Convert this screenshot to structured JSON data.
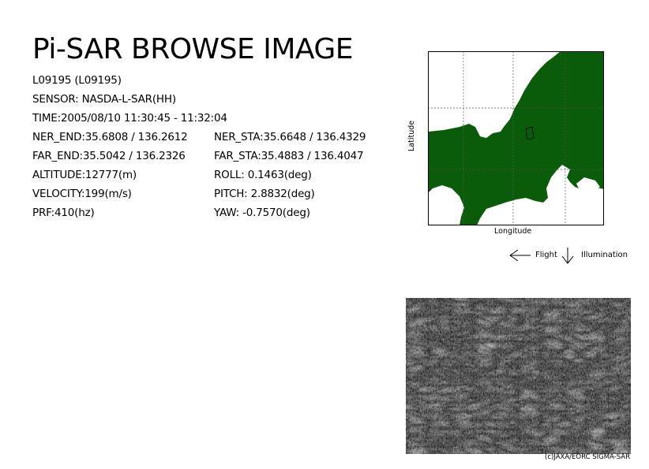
{
  "title": "Pi-SAR BROWSE IMAGE",
  "scene_id": "L09195 (L09195)",
  "sensor": "SENSOR: NASDA-L-SAR(HH)",
  "time": "TIME:2005/08/10  11:30:45 - 11:32:04",
  "left_column": [
    "NER_END:35.6808 / 136.2612",
    "FAR_END:35.5042 / 136.2326",
    "ALTITUDE:12777(m)",
    "VELOCITY:199(m/s)",
    "PRF:410(hz)"
  ],
  "right_column": [
    "NER_STA:35.6648 / 136.4329",
    "FAR_STA:35.4883 / 136.4047",
    "ROLL: 0.1463(deg)",
    "PITCH:  2.8832(deg)",
    "YAW:  -0.7570(deg)"
  ],
  "map": {
    "latitude_label": "Latitude",
    "longitude_label": "Longitude",
    "land_color": "#0a5c0a",
    "water_color": "#ffffff"
  },
  "legend": {
    "flight_label": "Flight",
    "illumination_label": "Illumination",
    "flight_icon": "arrow-left-icon",
    "illumination_icon": "arrow-down-icon"
  },
  "sar_image": {
    "description_icon": "sar-browse-image"
  },
  "credit": "(c)JAXA/EORC SIGMA-SAR"
}
